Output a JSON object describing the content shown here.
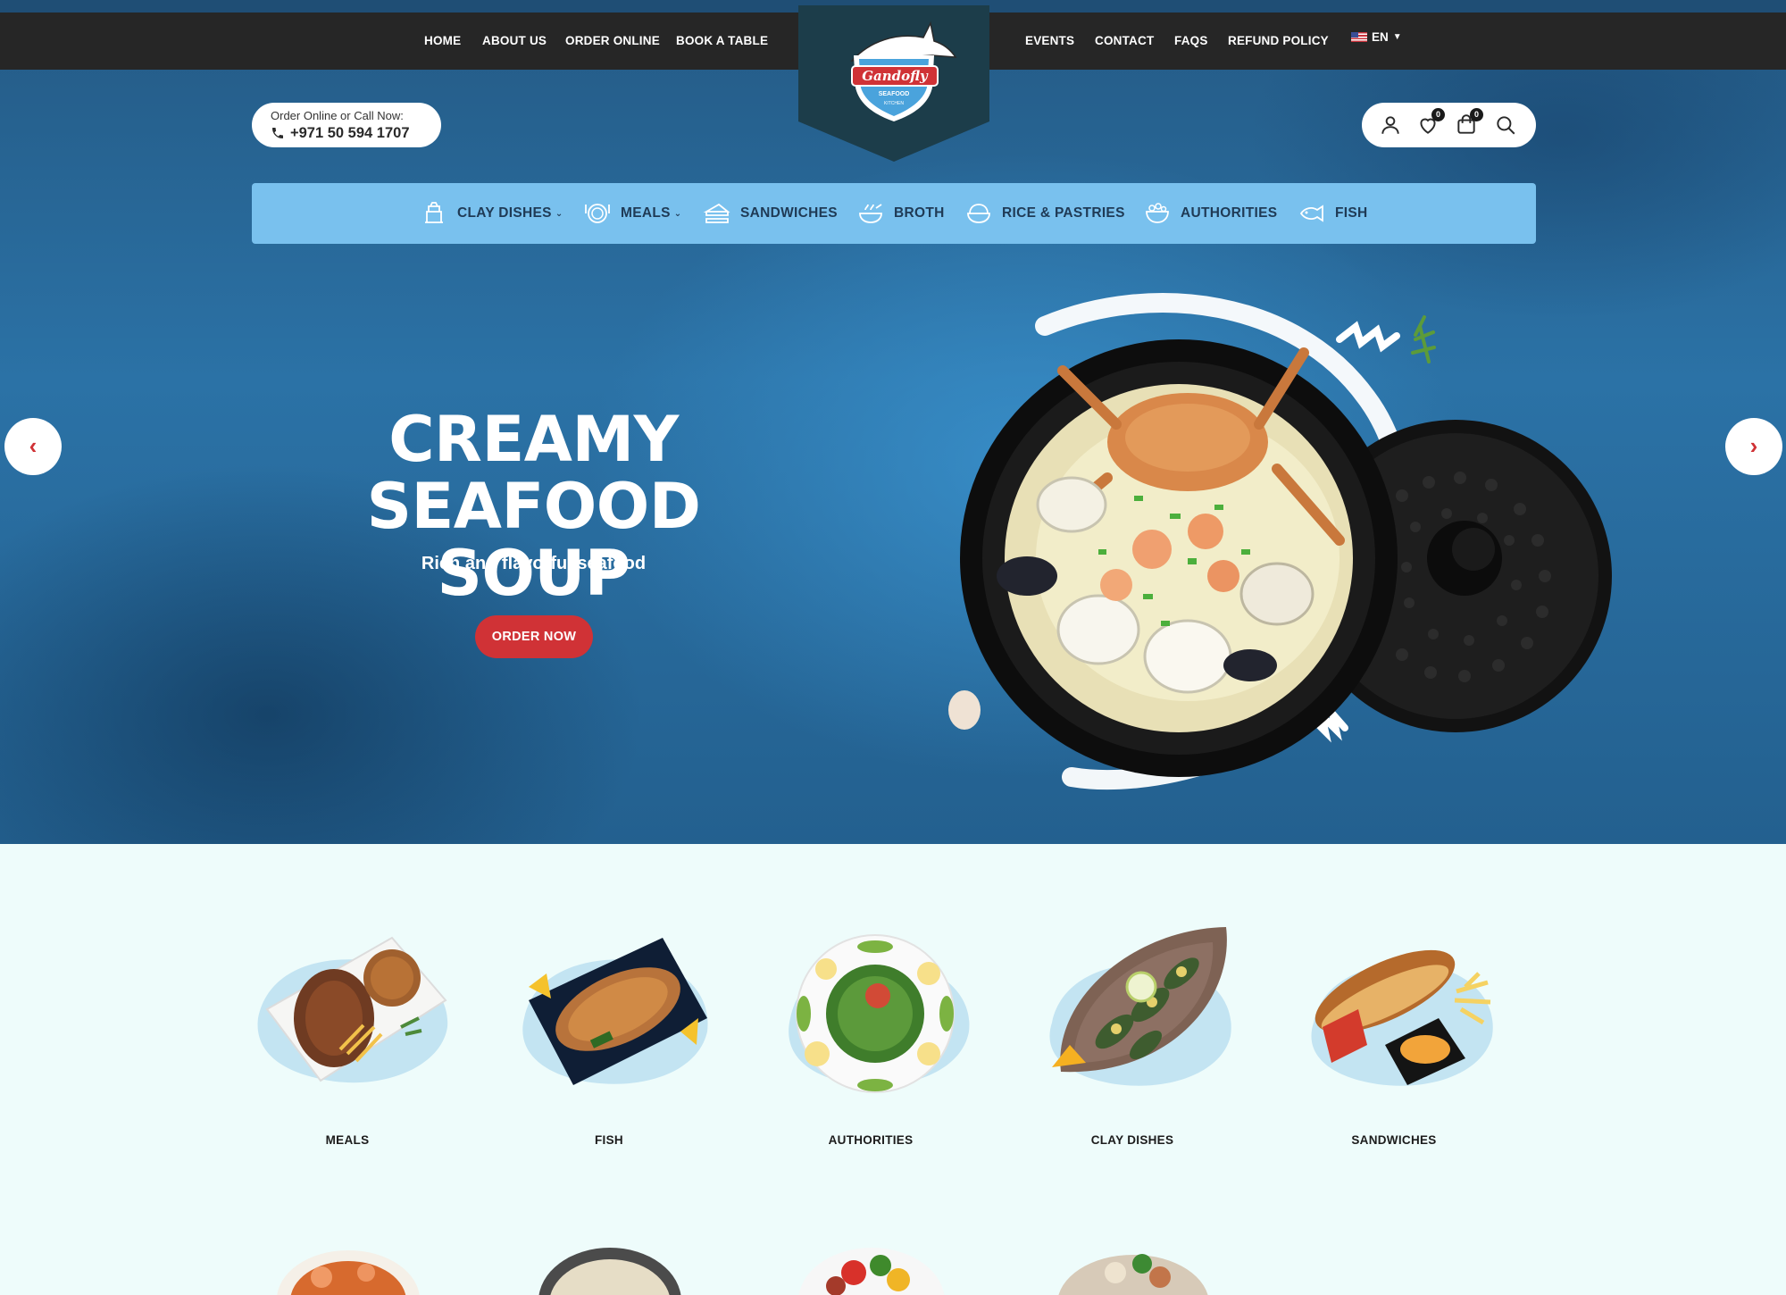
{
  "nav": {
    "left": [
      "HOME",
      "ABOUT US",
      "ORDER ONLINE",
      "BOOK A TABLE"
    ],
    "right": [
      "EVENTS",
      "CONTACT",
      "FAQS",
      "REFUND POLICY"
    ],
    "language": "EN"
  },
  "logo": {
    "brand": "Gandofly",
    "tagline": "SEAFOOD",
    "subline": "KITCHEN"
  },
  "contact": {
    "label": "Order Online or Call Now:",
    "phone": "+971 50 594 1707"
  },
  "header_icons": {
    "user": "user-icon",
    "wishlist": "heart-icon",
    "wishlist_count": "0",
    "cart": "cart-icon",
    "cart_count": "0",
    "search": "search-icon"
  },
  "categories_bar": [
    {
      "label": "CLAY DISHES",
      "icon": "clay-pot-icon",
      "dropdown": true
    },
    {
      "label": "MEALS",
      "icon": "plate-icon",
      "dropdown": true
    },
    {
      "label": "SANDWICHES",
      "icon": "sandwich-icon",
      "dropdown": false
    },
    {
      "label": "BROTH",
      "icon": "broth-bowl-icon",
      "dropdown": false
    },
    {
      "label": "RICE & PASTRIES",
      "icon": "rice-bowl-icon",
      "dropdown": false
    },
    {
      "label": "AUTHORITIES",
      "icon": "salad-bowl-icon",
      "dropdown": false
    },
    {
      "label": "FISH",
      "icon": "fish-icon",
      "dropdown": false
    }
  ],
  "hero": {
    "title_line1": "CREAMY SEAFOOD",
    "title_line2": "SOUP",
    "subtitle": "Rich and flavorful seafood",
    "cta": "ORDER NOW",
    "prev_icon": "chevron-left-icon",
    "next_icon": "chevron-right-icon"
  },
  "category_grid": [
    {
      "label": "MEALS",
      "image": "grilled-fish-meal-image"
    },
    {
      "label": "FISH",
      "image": "grilled-fish-tray-image"
    },
    {
      "label": "AUTHORITIES",
      "image": "tabbouleh-salad-image"
    },
    {
      "label": "CLAY DISHES",
      "image": "mussels-platter-image"
    },
    {
      "label": "SANDWICHES",
      "image": "sandwich-fries-image"
    }
  ],
  "colors": {
    "nav_bg": "#262626",
    "accent_red": "#d03236",
    "category_bar": "#79c1ee",
    "hero_blue": "#2b72a6",
    "page_bg": "#eefcfb"
  }
}
